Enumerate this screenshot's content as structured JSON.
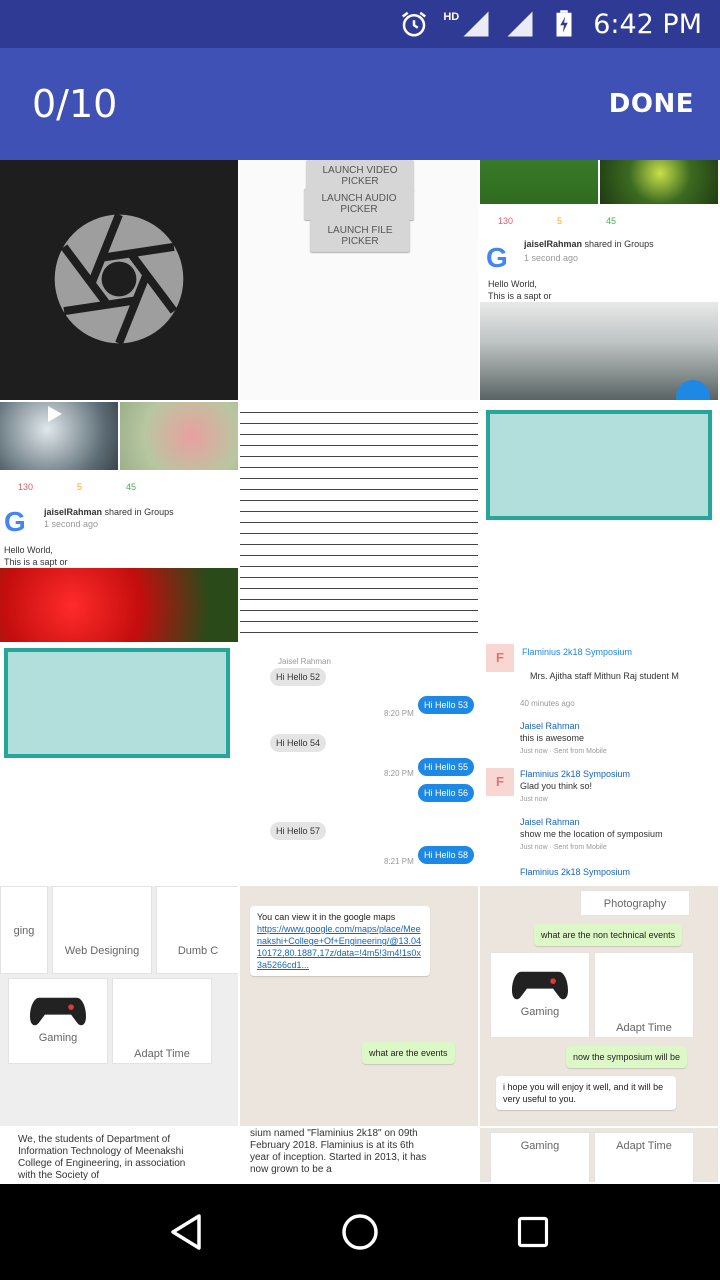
{
  "status_bar": {
    "time": "6:42 PM",
    "network_label": "HD"
  },
  "app_bar": {
    "counter": "0/10",
    "done_label": "DONE"
  },
  "tiles": {
    "picker_buttons": [
      "LAUNCH VIDEO PICKER",
      "LAUNCH AUDIO PICKER",
      "LAUNCH FILE PICKER"
    ],
    "post1": {
      "likes": "130",
      "comments": "5",
      "shares": "45",
      "author": "jaiselRahman",
      "action": "shared in Groups",
      "time": "1 second ago",
      "body1": "Hello World,",
      "body2": "This is a sapt or"
    },
    "post2": {
      "likes": "130",
      "comments": "5",
      "shares": "45",
      "author": "jaiselRahman",
      "action": "shared in Groups",
      "time": "1 second ago",
      "body1": "Hello World,",
      "body2": "This is a sapt or"
    },
    "chat": {
      "sender_label": "Jaisel Rahman",
      "m1": "Hi Hello 52",
      "r1": "Hi Hello 53",
      "m2": "Hi Hello 54",
      "r2": "Hi Hello 55",
      "r3": "Hi Hello 56",
      "m3": "Hi Hello 57",
      "r4": "Hi Hello 58",
      "time1": "8:20 PM",
      "time2": "8:20 PM",
      "time3": "8:21 PM"
    },
    "symposium": {
      "title": "Flaminius 2k18 Symposium",
      "tags": "Mrs. Ajitha staff  Mithun Raj student  M",
      "ago": "40 minutes ago",
      "c1_author": "Jaisel Rahman",
      "c1_text": "this is awesome",
      "c1_meta": "Just now · Sent from Mobile",
      "c2_author": "Flaminius 2k18 Symposium",
      "c2_text": "Glad you think so!",
      "c2_meta": "Just now",
      "c3_author": "Jaisel Rahman",
      "c3_text": "show me the location of symposium",
      "c3_meta": "Just now · Sent from Mobile",
      "c4_author": "Flaminius 2k18 Symposium"
    },
    "events": {
      "e1": "ging",
      "e2": "Web Designing",
      "e3": "Dumb C",
      "e4": "Gaming",
      "e5": "Adapt Time"
    },
    "wa1": {
      "intro": "You can view it in the google maps",
      "link": "https://www.google.com/maps/place/Meenakshi+College+Of+Engineering/@13.0410172,80.1887,17z/data=!4m5!3m4!1s0x3a5266cd1...",
      "msg": "what are the events"
    },
    "wa2": {
      "photo": "Photography",
      "q": "what are the non technical events",
      "g": "Gaming",
      "a": "Adapt Time",
      "sym": "now the symposium will be",
      "hope": "i hope you will enjoy it well, and it will be very useful to you."
    },
    "doc1": "We, the students of Department of Information Technology of Meenakshi College of Engineering, in association with the Society of",
    "doc2": "sium named \"Flaminius 2k18\" on 09th February 2018. Flaminius is at its 6th year of inception. Started in 2013, it has now grown to be a",
    "bottom_cards": {
      "g": "Gaming",
      "a": "Adapt Time"
    }
  }
}
